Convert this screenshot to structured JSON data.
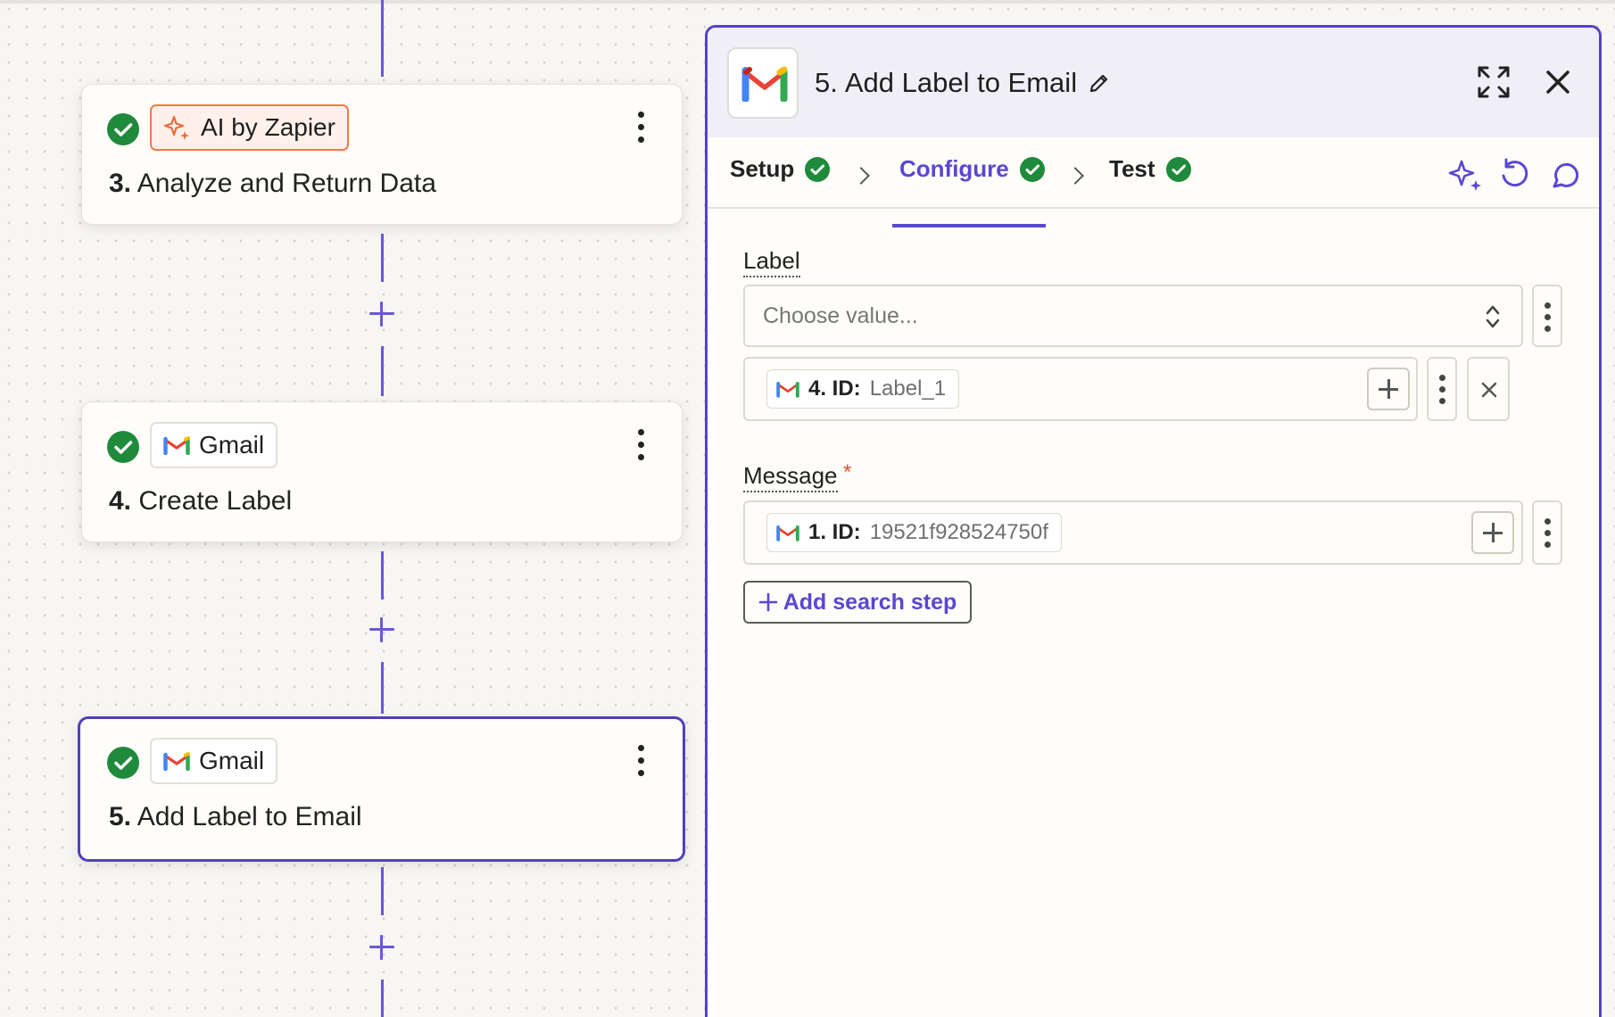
{
  "steps": [
    {
      "app": "AI by Zapier",
      "number": "3.",
      "title": "Analyze and Return Data",
      "app_icon": "ai-sparkle-icon"
    },
    {
      "app": "Gmail",
      "number": "4.",
      "title": "Create Label",
      "app_icon": "gmail-icon"
    },
    {
      "app": "Gmail",
      "number": "5.",
      "title": "Add Label to Email",
      "app_icon": "gmail-icon",
      "selected": true
    }
  ],
  "panel": {
    "number": "5.",
    "title": "Add Label to Email",
    "tabs": [
      {
        "label": "Setup",
        "complete": true
      },
      {
        "label": "Configure",
        "complete": true,
        "active": true
      },
      {
        "label": "Test",
        "complete": true
      }
    ],
    "fields": {
      "label": {
        "name": "Label",
        "placeholder": "Choose value...",
        "mapped": {
          "step": "4. ID:",
          "value": "Label_1"
        }
      },
      "message": {
        "name": "Message",
        "required_mark": "*",
        "mapped": {
          "step": "1. ID:",
          "value": "19521f928524750f"
        }
      }
    },
    "add_search_step": "Add search step"
  },
  "colors": {
    "accent": "#5a47d2",
    "success": "#1f8a3c",
    "ai_orange": "#ef7a4c",
    "connector": "#6b57d9"
  }
}
